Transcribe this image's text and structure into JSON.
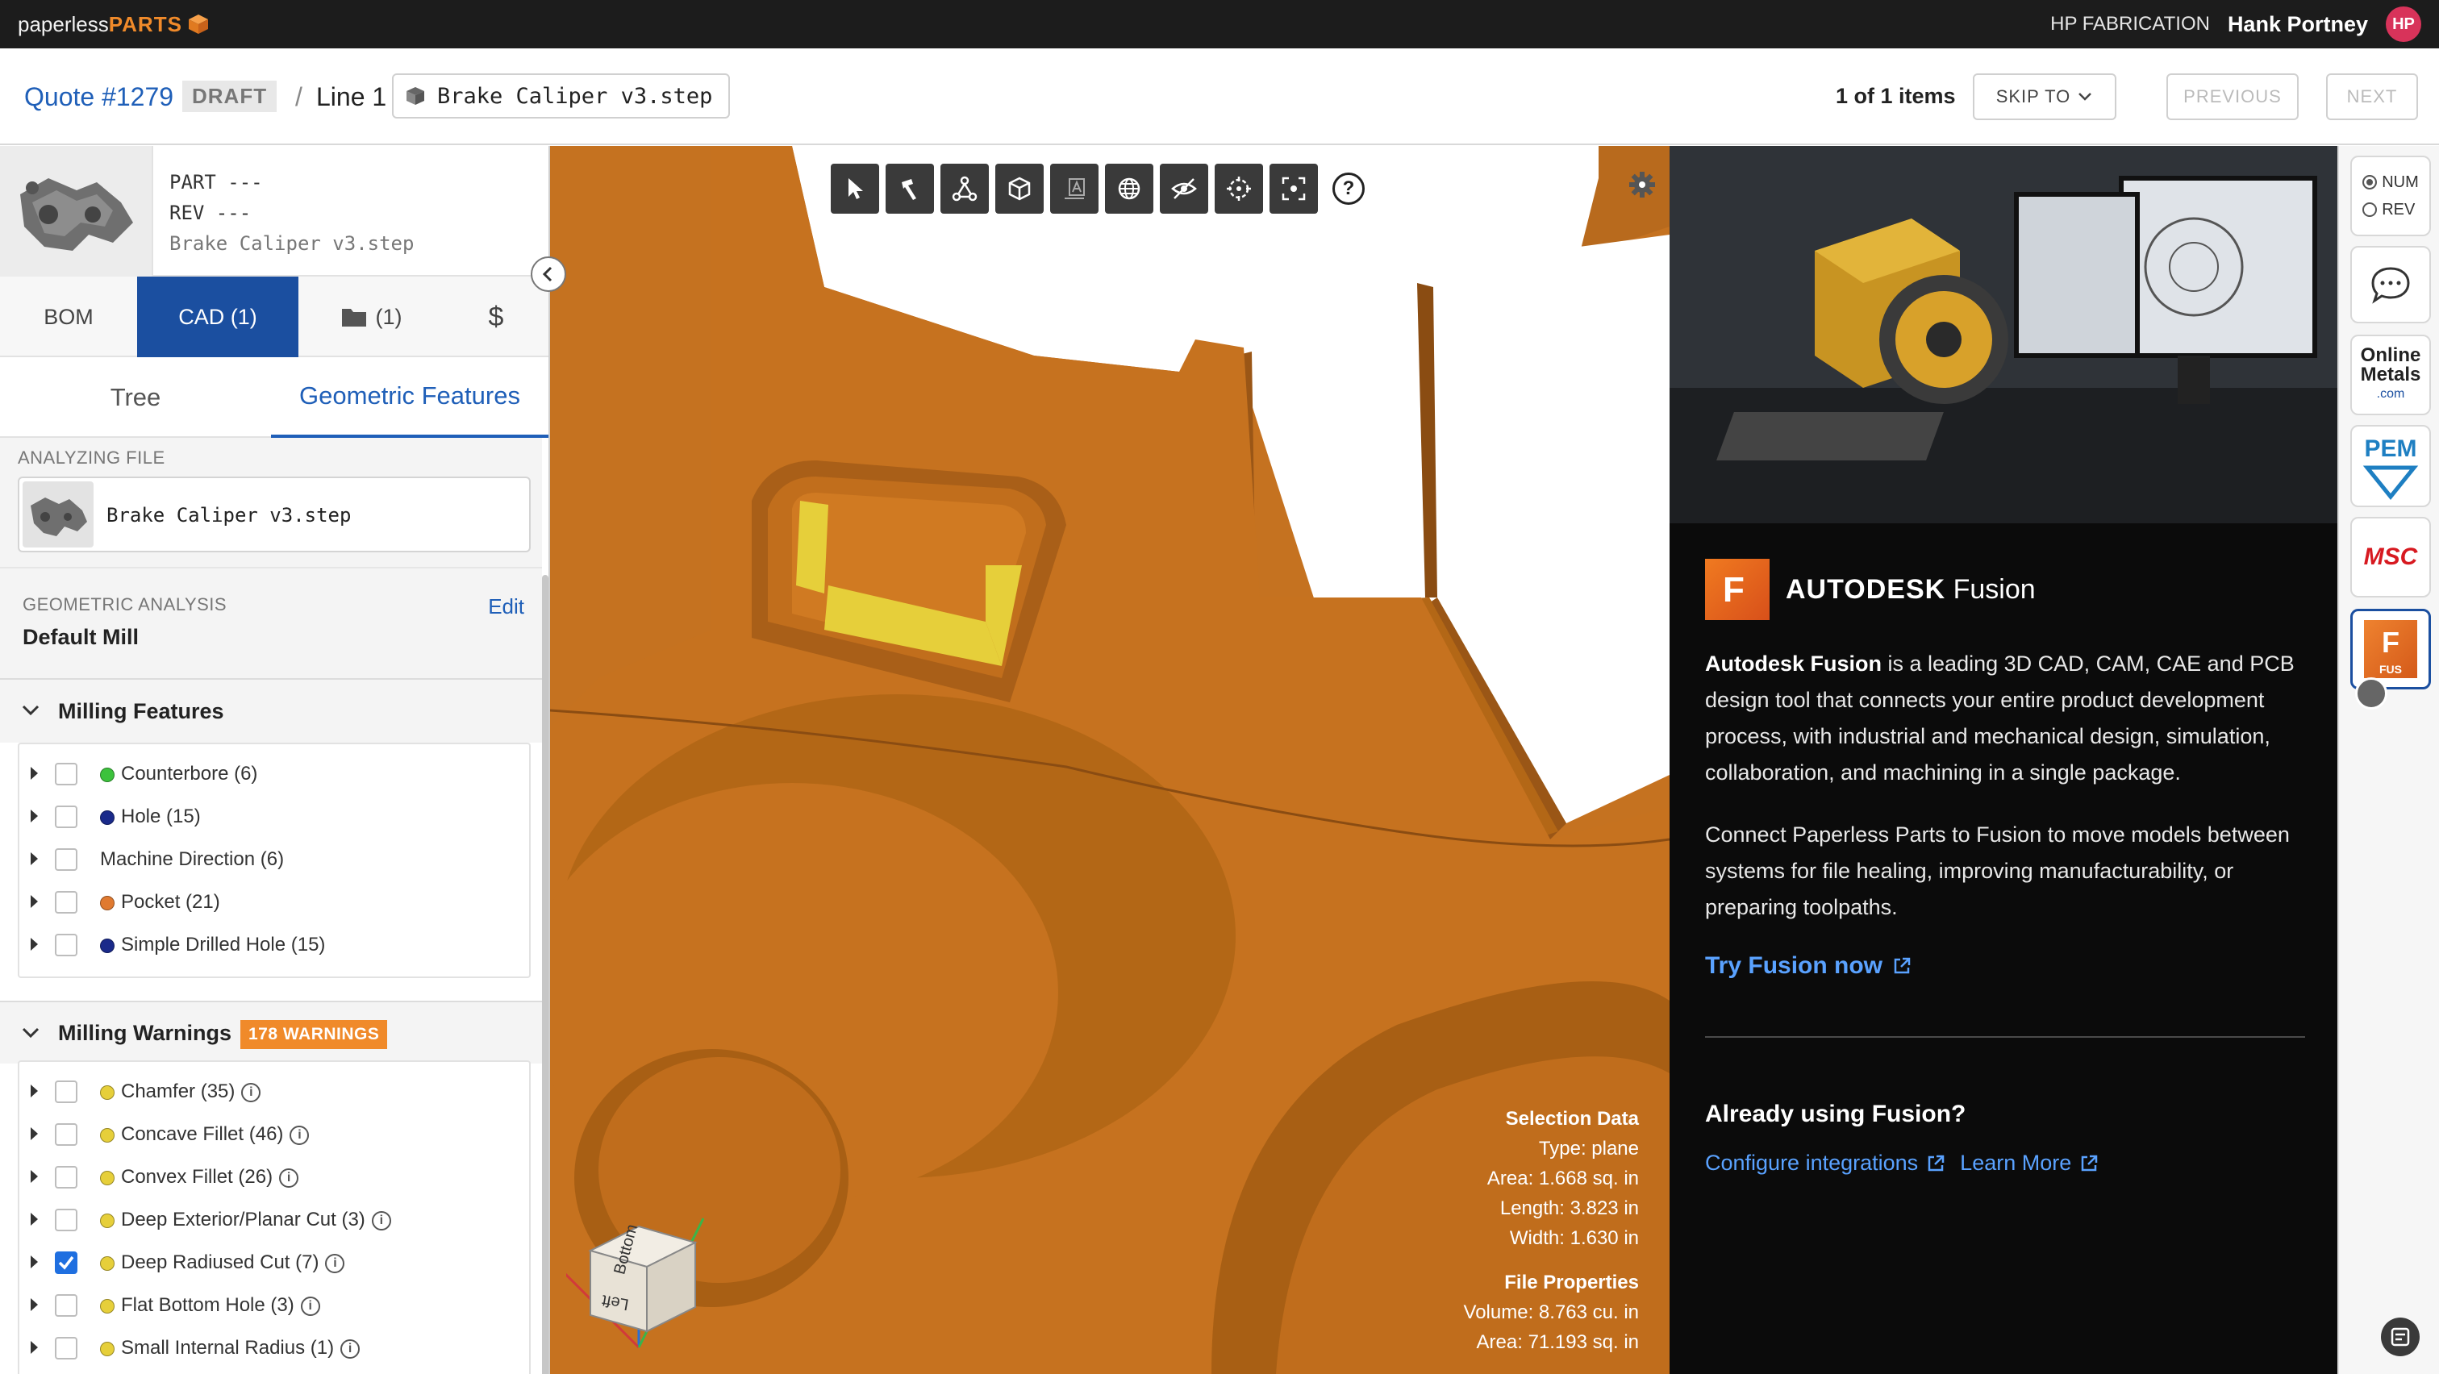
{
  "topbar": {
    "logo_light": "paperless",
    "logo_bold": "PARTS",
    "company": "HP FABRICATION",
    "user_name": "Hank Portney",
    "avatar_initials": "HP"
  },
  "header": {
    "quote": "Quote #1279",
    "status": "DRAFT",
    "separator": "/",
    "line": "Line 1",
    "file_name": "Brake Caliper v3.step",
    "items_count": "1 of 1 items",
    "skip_label": "SKIP TO",
    "previous_label": "PREVIOUS",
    "next_label": "NEXT"
  },
  "part": {
    "part_line": "PART ---",
    "rev_line": "REV  ---",
    "file_name": "Brake Caliper v3.step"
  },
  "tabs": {
    "bom": "BOM",
    "cad": "CAD (1)",
    "files": "(1)",
    "pricing": "$"
  },
  "subtabs": {
    "tree": "Tree",
    "geometric": "Geometric Features"
  },
  "analyzing": {
    "label": "ANALYZING FILE",
    "file_name": "Brake Caliper v3.step"
  },
  "geometric_analysis": {
    "label": "GEOMETRIC ANALYSIS",
    "value": "Default Mill",
    "edit_label": "Edit"
  },
  "milling_features": {
    "title": "Milling Features",
    "items": [
      {
        "label": "Counterbore (6)",
        "color": "#3cc23c",
        "checked": false
      },
      {
        "label": "Hole (15)",
        "color": "#1a2a8a",
        "checked": false
      },
      {
        "label": "Machine Direction (6)",
        "color": "",
        "checked": false
      },
      {
        "label": "Pocket (21)",
        "color": "#e07a30",
        "checked": false
      },
      {
        "label": "Simple Drilled Hole (15)",
        "color": "#1a2a8a",
        "checked": false
      }
    ]
  },
  "milling_warnings": {
    "title": "Milling Warnings",
    "badge": "178 WARNINGS",
    "items": [
      {
        "label": "Chamfer (35)",
        "color": "#e6cf3a",
        "checked": false
      },
      {
        "label": "Concave Fillet (46)",
        "color": "#e6cf3a",
        "checked": false
      },
      {
        "label": "Convex Fillet (26)",
        "color": "#e6cf3a",
        "checked": false
      },
      {
        "label": "Deep Exterior/Planar Cut (3)",
        "color": "#e6cf3a",
        "checked": false
      },
      {
        "label": "Deep Radiused Cut (7)",
        "color": "#e6cf3a",
        "checked": true
      },
      {
        "label": "Flat Bottom Hole (3)",
        "color": "#e6cf3a",
        "checked": false
      },
      {
        "label": "Small Internal Radius (1)",
        "color": "#e6cf3a",
        "checked": false
      }
    ]
  },
  "viewer": {
    "help_label": "?",
    "selection": {
      "title": "Selection Data",
      "type": "Type: plane",
      "area": "Area: 1.668 sq. in",
      "length": "Length: 3.823 in",
      "width": "Width: 1.630 in"
    },
    "file_props": {
      "title": "File Properties",
      "volume": "Volume: 8.763 cu. in",
      "area": "Area: 71.193 sq. in"
    },
    "cube": {
      "top_face": "Bottom",
      "front_face": "Left"
    }
  },
  "promo": {
    "brand_logo_letter": "F",
    "brand_bold": "AUTODESK",
    "brand_light": "Fusion",
    "para1_bold": "Autodesk Fusion",
    "para1_rest": " is a leading 3D CAD, CAM, CAE and PCB design tool that connects your entire product development process, with industrial and mechanical design, simulation, collaboration, and machining in a single package.",
    "para2": "Connect Paperless Parts to Fusion to move models between systems for file healing, improving manufacturability, or preparing toolpaths.",
    "try_label": "Try Fusion now",
    "already_label": "Already using Fusion?",
    "configure_label": "Configure integrations",
    "learn_label": "Learn More"
  },
  "rail": {
    "num_label": "NUM",
    "rev_label": "REV",
    "online_metals_line1": "Online",
    "online_metals_line2": "Metals",
    "online_metals_suffix": ".com",
    "pem_label": "PEM",
    "msc_label": "MSC",
    "fusion_letter": "F",
    "fusion_label": "FUS"
  },
  "colors": {
    "accent": "#1b4fa0",
    "link": "#1f5fb8",
    "warning": "#f08a2a",
    "part_orange": "#c8741e"
  }
}
